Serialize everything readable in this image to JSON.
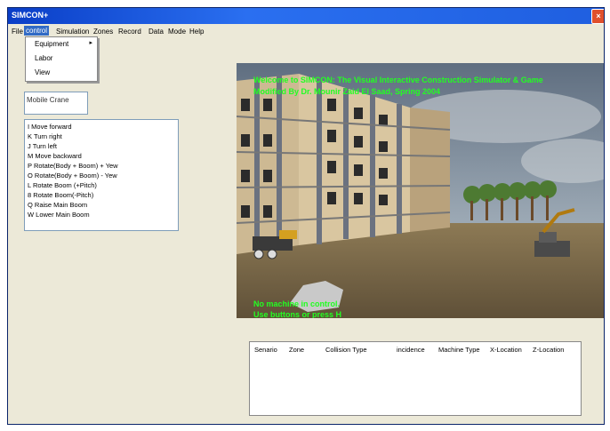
{
  "window": {
    "title": "SIMCON+",
    "close_label": "×"
  },
  "menu": {
    "items": [
      "File",
      "control",
      "Simulation",
      "Zones",
      "Record",
      "Data",
      "Mode",
      "Help"
    ],
    "active": "control"
  },
  "control_menu": {
    "items": [
      {
        "label": "Equipment",
        "submenu_arrow": "▸"
      },
      {
        "label": "Labor"
      },
      {
        "label": "View"
      }
    ]
  },
  "equipment_field": {
    "value": "Mobile Crane"
  },
  "key_commands": [
    "I  Move forward",
    "K  Turn right",
    "J  Turn left",
    "M  Move backward",
    "P  Rotate(Body + Boom) + Yew",
    "O  Rotate(Body + Boom) - Yew",
    "L  Rotate Boom (+Pitch)",
    "8  Rotate Boom(-Pitch)",
    "Q  Raise Main Boom",
    "W  Lower Main Boom"
  ],
  "viewport": {
    "header_line1": "Welcome to SIMCON: The Visual Interactive Construction Simulator & Game",
    "header_line2": "Modified By Dr. Mounir Zaid El Saad, Spring 2004",
    "status_line1": "No machine in control.",
    "status_line2": "Use buttons or press H",
    "text_color": "#22ff22"
  },
  "record_table": {
    "columns": [
      "Senario",
      "Zone",
      "Collision Type",
      "incidence",
      "Machine Type",
      "X-Location",
      "Z-Location"
    ],
    "rows": []
  }
}
